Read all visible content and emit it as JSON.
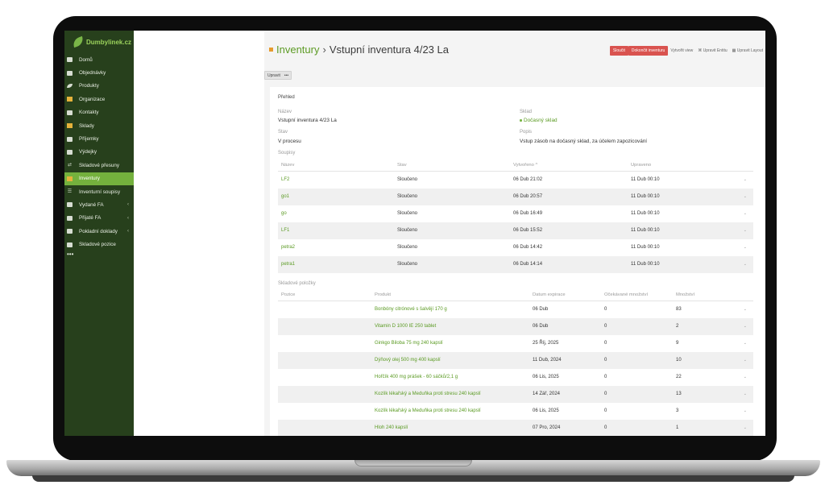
{
  "app": {
    "logo_text": "Dumbylinek.cz"
  },
  "sidebar": {
    "items": [
      {
        "label": "Domů",
        "icon": "grid-icon",
        "active": false
      },
      {
        "label": "Objednávky",
        "icon": "inbox-icon",
        "active": false
      },
      {
        "label": "Produkty",
        "icon": "leaf-icon",
        "active": false
      },
      {
        "label": "Organizace",
        "icon": "building-icon",
        "active": false
      },
      {
        "label": "Kontakty",
        "icon": "contacts-icon",
        "active": false
      },
      {
        "label": "Sklady",
        "icon": "warehouse-icon",
        "active": false
      },
      {
        "label": "Příjemky",
        "icon": "receipt-in-icon",
        "active": false
      },
      {
        "label": "Výdejky",
        "icon": "receipt-out-icon",
        "active": false
      },
      {
        "label": "Skladové přesuny",
        "icon": "transfer-icon",
        "active": false
      },
      {
        "label": "Inventury",
        "icon": "inventory-icon",
        "active": true
      },
      {
        "label": "Inventurní soupisy",
        "icon": "list-icon",
        "active": false
      },
      {
        "label": "Vydané FA",
        "icon": "invoice-icon",
        "active": false,
        "chevron": true
      },
      {
        "label": "Přijaté FA",
        "icon": "invoice-icon",
        "active": false,
        "chevron": true
      },
      {
        "label": "Pokladní doklady",
        "icon": "cash-icon",
        "active": false,
        "chevron": true
      },
      {
        "label": "Skladové pozice",
        "icon": "position-icon",
        "active": false
      }
    ],
    "more_label": "•••"
  },
  "header": {
    "breadcrumb_root": "Inventury",
    "separator": "›",
    "title": "Vstupní inventura 4/23 La",
    "actions": {
      "merge": "Sloučit",
      "finish": "Dokončit inventuru",
      "create_view": "Vytvořit view",
      "edit_entity": "Upravit Entitu",
      "edit_layout": "Upravit Layout"
    }
  },
  "toolbar": {
    "edit_label": "Upravit",
    "more_label": "•••"
  },
  "overview": {
    "title": "Přehled",
    "name_label": "Název",
    "name_value": "Vstupní inventura 4/23 La",
    "warehouse_label": "Sklad",
    "warehouse_value": "Dočasný sklad",
    "state_label": "Stav",
    "state_value": "V procesu",
    "desc_label": "Popis",
    "desc_value": "Vstup zásob na dočasný sklad, za účelem zapozicování"
  },
  "soupisy": {
    "label": "Soupisy",
    "columns": [
      "Název",
      "Stav",
      "Vytvořeno ^",
      "Upraveno"
    ],
    "rows": [
      {
        "name": "LF2",
        "state": "Sloučeno",
        "created": "06 Dub 21:02",
        "updated": "11 Dub 00:10"
      },
      {
        "name": "go1",
        "state": "Sloučeno",
        "created": "06 Dub 20:57",
        "updated": "11 Dub 00:10"
      },
      {
        "name": "go",
        "state": "Sloučeno",
        "created": "06 Dub 16:49",
        "updated": "11 Dub 00:10"
      },
      {
        "name": "LF1",
        "state": "Sloučeno",
        "created": "06 Dub 15:52",
        "updated": "11 Dub 00:10"
      },
      {
        "name": "petra2",
        "state": "Sloučeno",
        "created": "06 Dub 14:42",
        "updated": "11 Dub 00:10"
      },
      {
        "name": "petra1",
        "state": "Sloučeno",
        "created": "06 Dub 14:14",
        "updated": "11 Dub 00:10"
      }
    ]
  },
  "polozky": {
    "label": "Skladové položky",
    "columns": [
      "Pozice",
      "Produkt",
      "Datum expirace",
      "Očekávané množství",
      "Množství"
    ],
    "rows": [
      {
        "position": "",
        "product": "Bonbóny citrónové s šalvějí 170 g",
        "expiry": "06 Dub",
        "expected": "0",
        "qty": "83"
      },
      {
        "position": "",
        "product": "Vitamin D 1000 IE 250 tablet",
        "expiry": "06 Dub",
        "expected": "0",
        "qty": "2"
      },
      {
        "position": "",
        "product": "Ginkgo Biloba 75 mg 240 kapslí",
        "expiry": "25 Říj, 2025",
        "expected": "0",
        "qty": "9"
      },
      {
        "position": "",
        "product": "Dýňový olej 500 mg 400 kapslí",
        "expiry": "11 Dub, 2024",
        "expected": "0",
        "qty": "10"
      },
      {
        "position": "",
        "product": "Hořčík 400 mg prášek - 60 sáčků/2,1 g",
        "expiry": "06 Lis, 2025",
        "expected": "0",
        "qty": "22"
      },
      {
        "position": "",
        "product": "Kozlík lékařský a Meduňka proti stresu 240 kapslí",
        "expiry": "14 Zář, 2024",
        "expected": "0",
        "qty": "13"
      },
      {
        "position": "",
        "product": "Kozlík lékařský a Meduňka proti stresu 240 kapslí",
        "expiry": "06 Lis, 2025",
        "expected": "0",
        "qty": "3"
      },
      {
        "position": "",
        "product": "Hloh 240 kapslí",
        "expiry": "07 Pro, 2024",
        "expected": "0",
        "qty": "1"
      }
    ]
  },
  "colors": {
    "brand_green": "#5a9a22",
    "sidebar_bg": "#27401c",
    "active_item": "#74b13d",
    "danger": "#d9534f"
  }
}
